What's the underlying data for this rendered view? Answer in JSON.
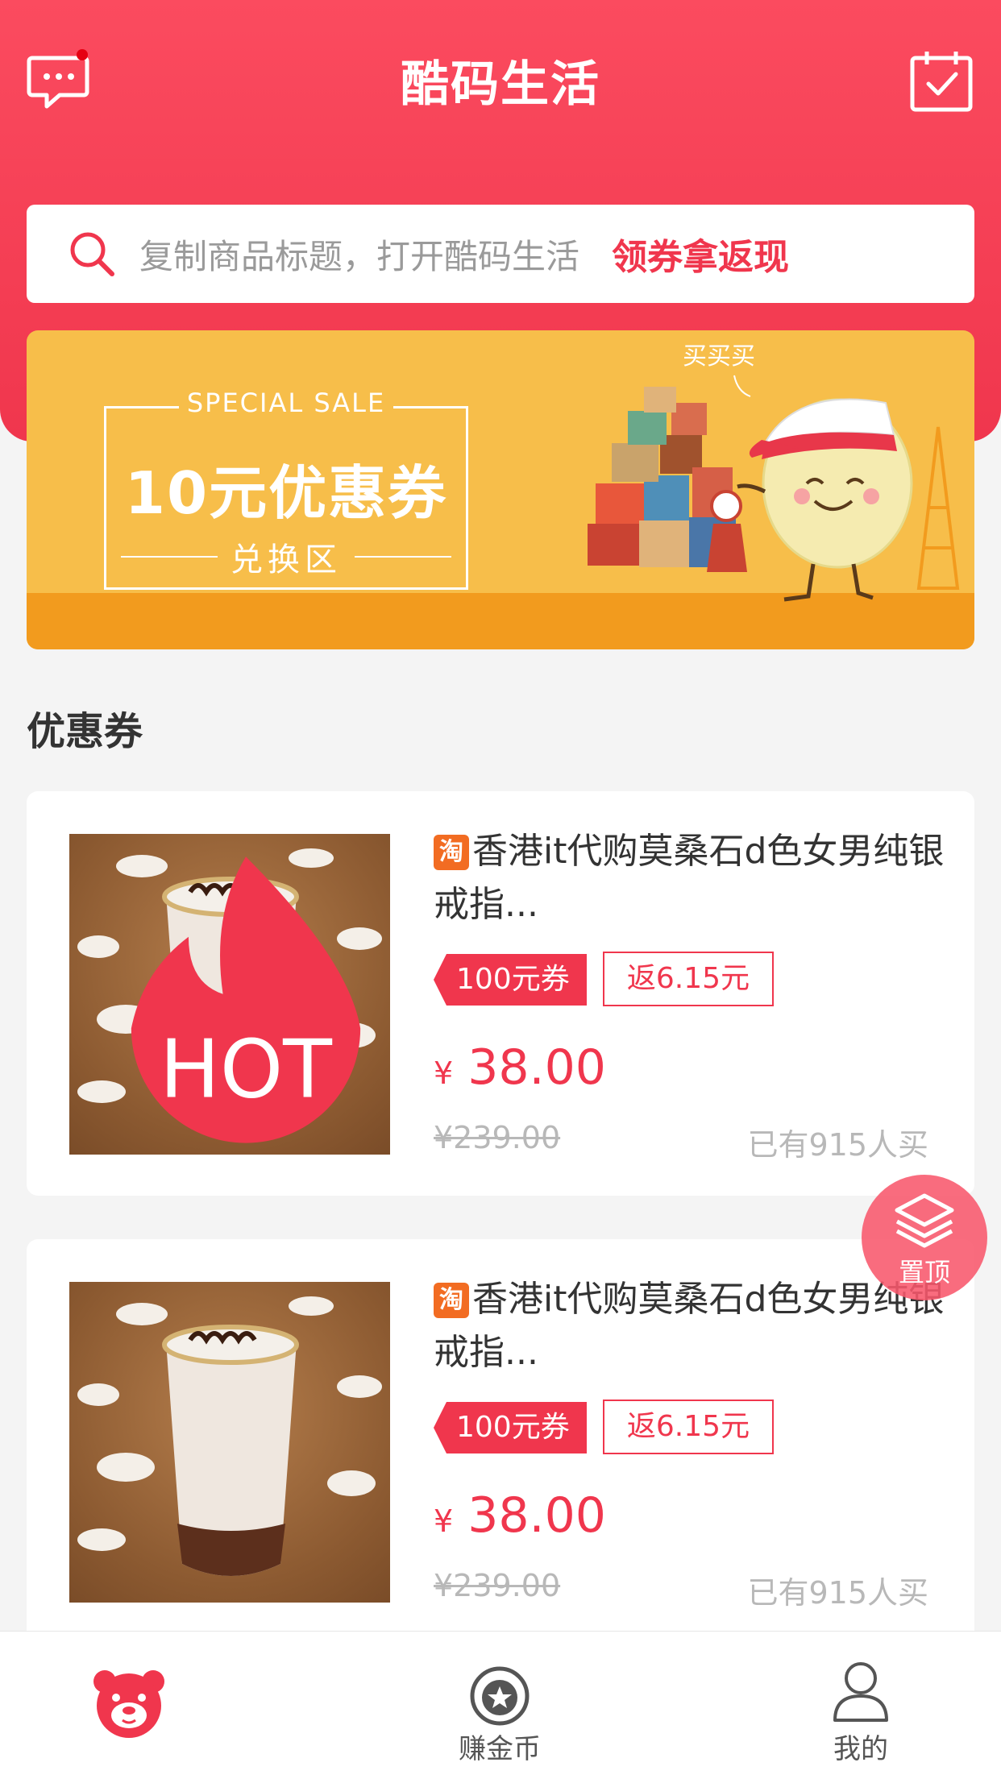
{
  "header": {
    "title": "酷码生活",
    "message_icon": "message-icon",
    "calendar_icon": "calendar-check-icon",
    "has_unread": true
  },
  "search": {
    "placeholder": "复制商品标题，打开酷码生活",
    "cta": "领券拿返现"
  },
  "banner": {
    "tag": "SPECIAL SALE",
    "headline": "10元优惠券",
    "subline": "兑换区",
    "bubble": "买买买"
  },
  "section": {
    "title": "优惠券"
  },
  "products": [
    {
      "platform_badge": "淘",
      "hot_badge": "HOT",
      "title": "香港it代购莫桑石d色女男纯银戒指...",
      "coupon": "100元券",
      "rebate": "返6.15元",
      "currency": "¥",
      "price": "38.00",
      "original_price": "¥239.00",
      "sold": "已有915人买"
    },
    {
      "platform_badge": "淘",
      "title": "香港it代购莫桑石d色女男纯银戒指...",
      "coupon": "100元券",
      "rebate": "返6.15元",
      "currency": "¥",
      "price": "38.00",
      "original_price": "¥239.00",
      "sold": "已有915人买"
    }
  ],
  "floating": {
    "to_top_label": "置顶"
  },
  "tabbar": {
    "items": [
      {
        "label": "",
        "icon": "bear-home-icon",
        "active": true
      },
      {
        "label": "赚金币",
        "icon": "coin-star-icon",
        "active": false
      },
      {
        "label": "我的",
        "icon": "user-icon",
        "active": false
      }
    ]
  },
  "colors": {
    "primary": "#f0364d",
    "banner_yellow": "#f7be4a",
    "banner_orange": "#f29b1e",
    "taobao_orange": "#f26c22",
    "muted": "#b8b8b8"
  }
}
